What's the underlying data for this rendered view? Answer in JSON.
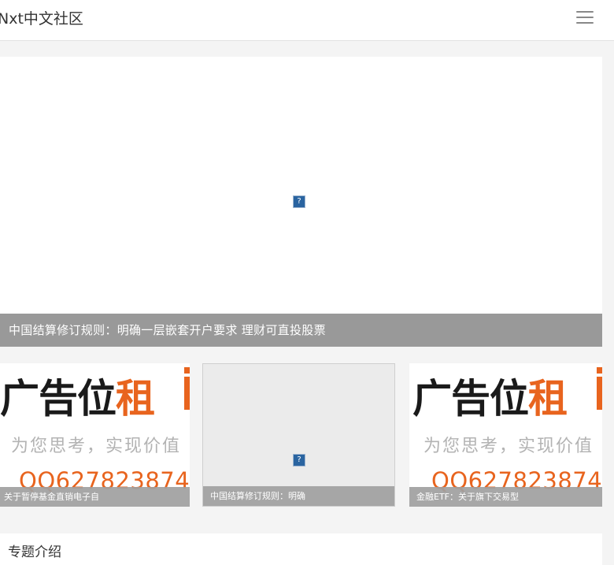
{
  "header": {
    "brand": "Nxt中文社区",
    "menu_icon": "hamburger-menu-icon"
  },
  "hero": {
    "image_icon": "broken-image-icon",
    "caption": "中国结算修订规则：明确一层嵌套开户要求 理财可直投股票"
  },
  "cards": [
    {
      "ad": {
        "title_dark": "广告位",
        "title_accent": "租",
        "slogan": "为您思考，实现价值",
        "qq": "QQ627823874"
      },
      "caption": "关于暂停基金直销电子自"
    },
    {
      "image_icon": "broken-image-icon",
      "caption": "中国结算修订规则：明确"
    },
    {
      "ad": {
        "title_dark": "广告位",
        "title_accent": "租",
        "slogan": "为您思考，实现价值",
        "qq": "QQ627823874"
      },
      "caption": "金融ETF：关于旗下交易型"
    }
  ],
  "section": {
    "title": "专题介绍"
  },
  "colors": {
    "accent": "#e8641e",
    "caption_bg": "#999999",
    "page_bg": "#f4f4f4"
  }
}
